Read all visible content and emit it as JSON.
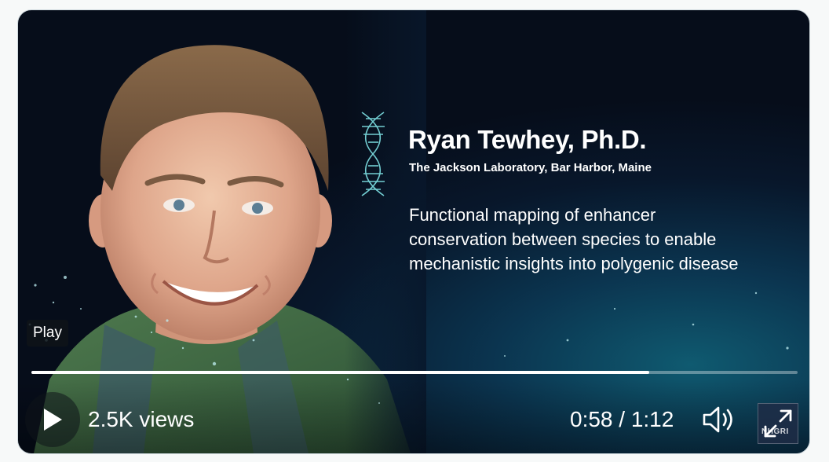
{
  "video": {
    "speaker_name": "Ryan Tewhey, Ph.D.",
    "speaker_affiliation": "The Jackson Laboratory, Bar Harbor, Maine",
    "talk_title": "Functional mapping of enhancer\nconservation between species to enable\nmechanistic insights into polygenic disease",
    "logo_text": "NHGRI"
  },
  "controls": {
    "play_tooltip": "Play",
    "views": "2.5K views",
    "timecode": "0:58 / 1:12",
    "progress_fraction": 0.806,
    "play_icon": "play-icon",
    "volume_icon": "volume-icon",
    "fullscreen_icon": "expand-icon"
  },
  "colors": {
    "background_dark": "#08172b",
    "background_teal": "#0f5a70",
    "text": "#ffffff",
    "dna_cyan": "#7fe3e6"
  }
}
